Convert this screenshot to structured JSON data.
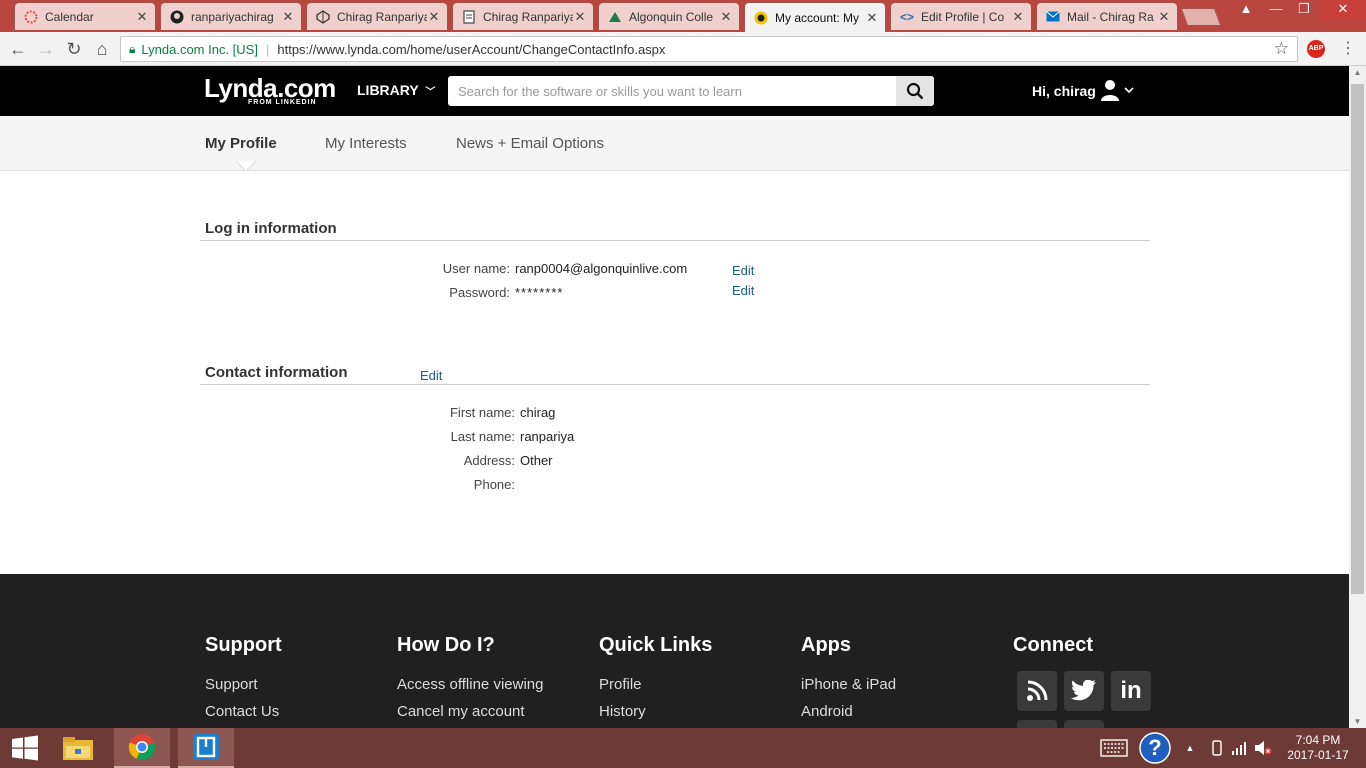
{
  "browser": {
    "tabs": [
      {
        "title": "Calendar",
        "icon": "calendar-icon",
        "active": false
      },
      {
        "title": "ranpariyachirag",
        "icon": "github-icon",
        "active": false
      },
      {
        "title": "Chirag Ranpariya",
        "icon": "codepen-icon",
        "active": false
      },
      {
        "title": "Chirag Ranpariya",
        "icon": "document-icon",
        "active": false
      },
      {
        "title": "Algonquin Colle",
        "icon": "algonquin-icon",
        "active": false
      },
      {
        "title": "My account: My",
        "icon": "lynda-icon",
        "active": true
      },
      {
        "title": "Edit Profile | Co",
        "icon": "code-icon",
        "active": false
      },
      {
        "title": "Mail - Chirag Ra",
        "icon": "mail-icon",
        "active": false
      }
    ],
    "secure_label": "Lynda.com Inc. [US]",
    "url": "https://www.lynda.com/home/userAccount/ChangeContactInfo.aspx",
    "adblock_label": "ABP"
  },
  "header": {
    "logo_main": "Lynda.com",
    "logo_sub": "FROM LINKEDIN",
    "library_label": "LIBRARY",
    "search_placeholder": "Search for the software or skills you want to learn",
    "greeting": "Hi, chirag"
  },
  "subnav": {
    "tabs": [
      "My Profile",
      "My Interests",
      "News + Email Options"
    ],
    "selected": "My Profile"
  },
  "login_info": {
    "title": "Log in information",
    "username_label": "User name:",
    "username_value": "ranp0004@algonquinlive.com",
    "password_label": "Password:",
    "password_value": "********",
    "edit_label": "Edit"
  },
  "contact_info": {
    "title": "Contact information",
    "edit_label": "Edit",
    "first_name_label": "First name:",
    "first_name_value": "chirag",
    "last_name_label": "Last name:",
    "last_name_value": "ranpariya",
    "address_label": "Address:",
    "address_value": "Other",
    "phone_label": "Phone:",
    "phone_value": ""
  },
  "footer": {
    "support": {
      "title": "Support",
      "links": [
        "Support",
        "Contact Us"
      ]
    },
    "howdoi": {
      "title": "How Do I?",
      "links": [
        "Access offline viewing",
        "Cancel my account"
      ]
    },
    "quicklinks": {
      "title": "Quick Links",
      "links": [
        "Profile",
        "History"
      ]
    },
    "apps": {
      "title": "Apps",
      "links": [
        "iPhone & iPad",
        "Android"
      ]
    },
    "connect": {
      "title": "Connect",
      "icons": [
        "rss-icon",
        "twitter-icon",
        "linkedin-icon"
      ],
      "linkedin_label": "in"
    }
  },
  "taskbar": {
    "time": "7:04 PM",
    "date": "2017-01-17",
    "help_label": "?"
  },
  "colors": {
    "header_bg": "#000000",
    "footer_bg": "#202020",
    "link": "#1c5c86",
    "tabstrip": "#b9473f",
    "taskbar": "#6e3a35"
  }
}
